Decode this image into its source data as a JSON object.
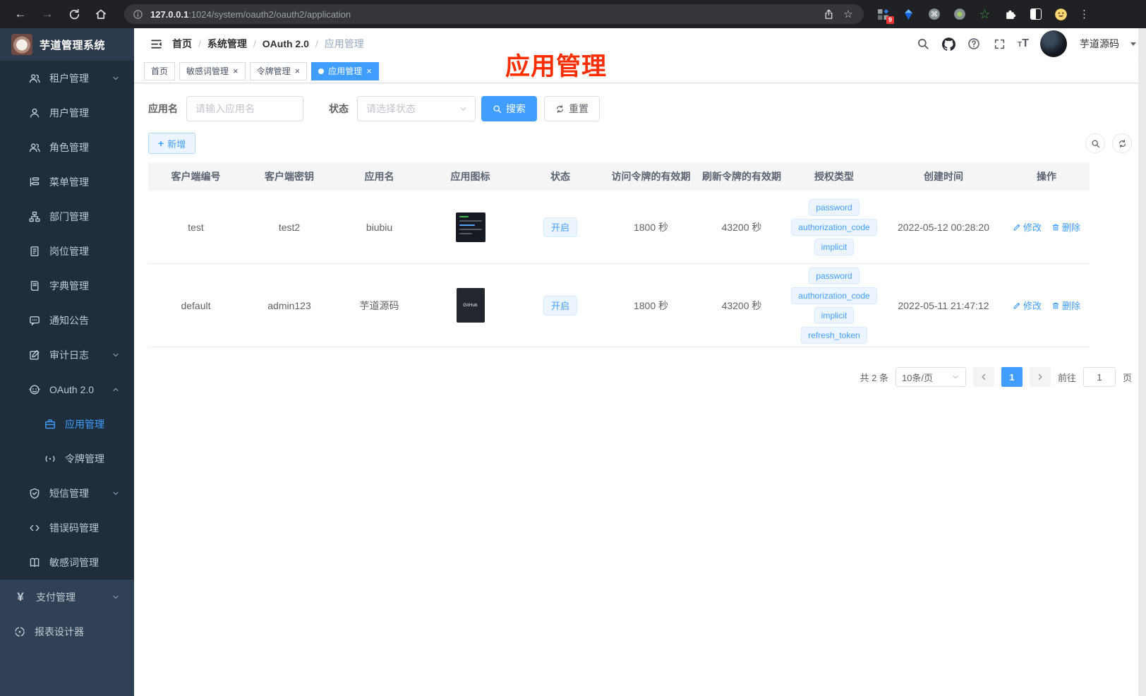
{
  "browser": {
    "url_host": "127.0.0.1",
    "url_rest": ":1024/system/oauth2/oauth2/application",
    "extension_badge": "9",
    "glyphs": {
      "back": "←",
      "forward": "→",
      "bookmark_star": "☆",
      "cmd": "⌘",
      "ext_star": "☆",
      "menu_dots": "⋮"
    }
  },
  "sidebar": {
    "logo_title": "芋道管理系统",
    "pay_glyph": "¥",
    "items": [
      {
        "label": "租户管理",
        "icon": "users-icon",
        "arrow": "down"
      },
      {
        "label": "用户管理",
        "icon": "user-icon"
      },
      {
        "label": "角色管理",
        "icon": "user-group-icon"
      },
      {
        "label": "菜单管理",
        "icon": "tree-list-icon"
      },
      {
        "label": "部门管理",
        "icon": "org-chart-icon"
      },
      {
        "label": "岗位管理",
        "icon": "id-badge-icon"
      },
      {
        "label": "字典管理",
        "icon": "book-icon"
      },
      {
        "label": "通知公告",
        "icon": "message-icon"
      },
      {
        "label": "审计日志",
        "icon": "edit-note-icon",
        "arrow": "down"
      },
      {
        "label": "OAuth 2.0",
        "icon": "robot-icon",
        "arrow": "up"
      },
      {
        "label": "应用管理",
        "icon": "briefcase-icon",
        "active": true
      },
      {
        "label": "令牌管理",
        "icon": "signal-icon"
      },
      {
        "label": "短信管理",
        "icon": "shield-check-icon",
        "arrow": "down"
      },
      {
        "label": "错误码管理",
        "icon": "code-brackets-icon"
      },
      {
        "label": "敏感词管理",
        "icon": "open-book-icon"
      },
      {
        "label": "支付管理",
        "icon": "yen-icon",
        "arrow": "down"
      },
      {
        "label": "报表设计器",
        "icon": "pie-segments-icon"
      }
    ]
  },
  "navbar": {
    "breadcrumb": [
      "首页",
      "系统管理",
      "OAuth 2.0",
      "应用管理"
    ],
    "separator": "/",
    "username": "芋道源码",
    "text_size_glyph": "T"
  },
  "tabs": [
    {
      "label": "首页"
    },
    {
      "label": "敏感词管理",
      "closable": true
    },
    {
      "label": "令牌管理",
      "closable": true
    },
    {
      "label": "应用管理",
      "closable": true,
      "active": true
    }
  ],
  "annotation": {
    "text": "应用管理"
  },
  "filters": {
    "name_label": "应用名",
    "name_placeholder": "请输入应用名",
    "status_label": "状态",
    "status_placeholder": "请选择状态",
    "search_label": "搜索",
    "reset_label": "重置"
  },
  "toolbar": {
    "add_label": "新增",
    "plus_glyph": "+"
  },
  "actions": {
    "edit": "修改",
    "delete": "删除"
  },
  "ui": {
    "close_glyph": "×"
  },
  "table": {
    "columns": [
      "客户端编号",
      "客户端密钥",
      "应用名",
      "应用图标",
      "状态",
      "访问令牌的有效期",
      "刷新令牌的有效期",
      "授权类型",
      "创建时间",
      "操作"
    ],
    "rows": [
      {
        "client_id": "test",
        "secret": "test2",
        "name": "biubiu",
        "icon": "dashboard-screenshot",
        "status": "开启",
        "access_validity": "1800 秒",
        "refresh_validity": "43200 秒",
        "grant_types": [
          "password",
          "authorization_code",
          "implicit"
        ],
        "created_at": "2022-05-12 00:28:20"
      },
      {
        "client_id": "default",
        "secret": "admin123",
        "name": "芋道源码",
        "icon": "github-dark",
        "icon_text": "GitHub",
        "status": "开启",
        "access_validity": "1800 秒",
        "refresh_validity": "43200 秒",
        "grant_types": [
          "password",
          "authorization_code",
          "implicit",
          "refresh_token"
        ],
        "created_at": "2022-05-11 21:47:12"
      }
    ]
  },
  "pagination": {
    "total": "共 2 条",
    "page_size": "10条/页",
    "current_page": "1",
    "goto_label": "前往",
    "goto_value": "1",
    "page_label": "页"
  },
  "colors": {
    "accent": "#409EFF",
    "tag_bg": "#ecf5ff",
    "tag_border": "#d9ecff",
    "sidebar_bg": "#304156",
    "submenu_bg": "#1f2d3d",
    "annotation_red": "#ff2d00",
    "tab_active": "#409EFF"
  }
}
